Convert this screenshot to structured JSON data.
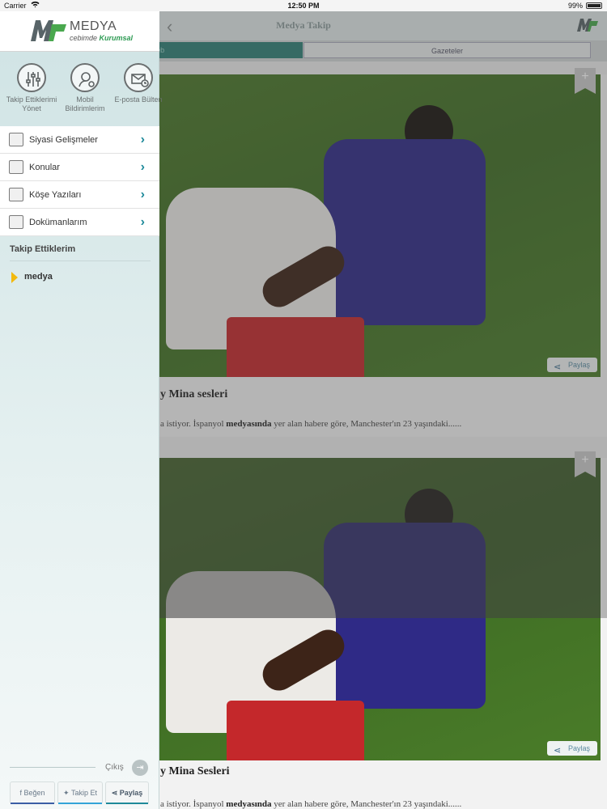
{
  "status_bar": {
    "carrier": "Carrier",
    "time": "12:50 PM",
    "battery": "99%"
  },
  "navbar": {
    "back_icon": "‹",
    "title": "Medya Takip"
  },
  "segments": {
    "left": "Web",
    "right": "Gazeteler"
  },
  "side_menu": {
    "brand": {
      "name": "MEDYA",
      "sub_prefix": "cebimde",
      "sub_accent": "Kurumsal"
    },
    "quick_actions": [
      {
        "label": "Takip Ettiklerimi Yönet",
        "icon": "sliders-icon"
      },
      {
        "label": "Mobil Bildirimlerim",
        "icon": "user-gear-icon"
      },
      {
        "label": "E-posta Bülten",
        "icon": "mail-clock-icon"
      }
    ],
    "items": [
      {
        "label": "Siyasi Gelişmeler"
      },
      {
        "label": "Konular"
      },
      {
        "label": "Köşe Yazıları"
      },
      {
        "label": "Dokümanlarım"
      }
    ],
    "follow_title": "Takip Ettiklerim",
    "follow_items": [
      {
        "label": "medya"
      }
    ],
    "logout": "Çıkış",
    "social": {
      "like": "Beğen",
      "follow": "Takip Et",
      "share": "Paylaş"
    }
  },
  "articles": [
    {
      "title": "y Mina sesleri",
      "text_prefix": "a istiyor. İspanyol ",
      "text_highlight": "medyasında",
      "text_suffix": " yer alan habere göre, Manchester'ın 23 yaşındaki......",
      "share_label": "Paylaş",
      "bookmark": "+"
    },
    {
      "title": "y Mina Sesleri",
      "text_prefix": "a istiyor. İspanyol ",
      "text_highlight": "medyasında",
      "text_suffix": " yer alan habere göre, Manchester'ın 23 yaşındaki......",
      "share_label": "Paylaş",
      "bookmark": "+"
    }
  ],
  "colors": {
    "accent": "#1f8a9a",
    "segment_active": "#2f7f76",
    "follow_marker": "#f2b90f"
  }
}
